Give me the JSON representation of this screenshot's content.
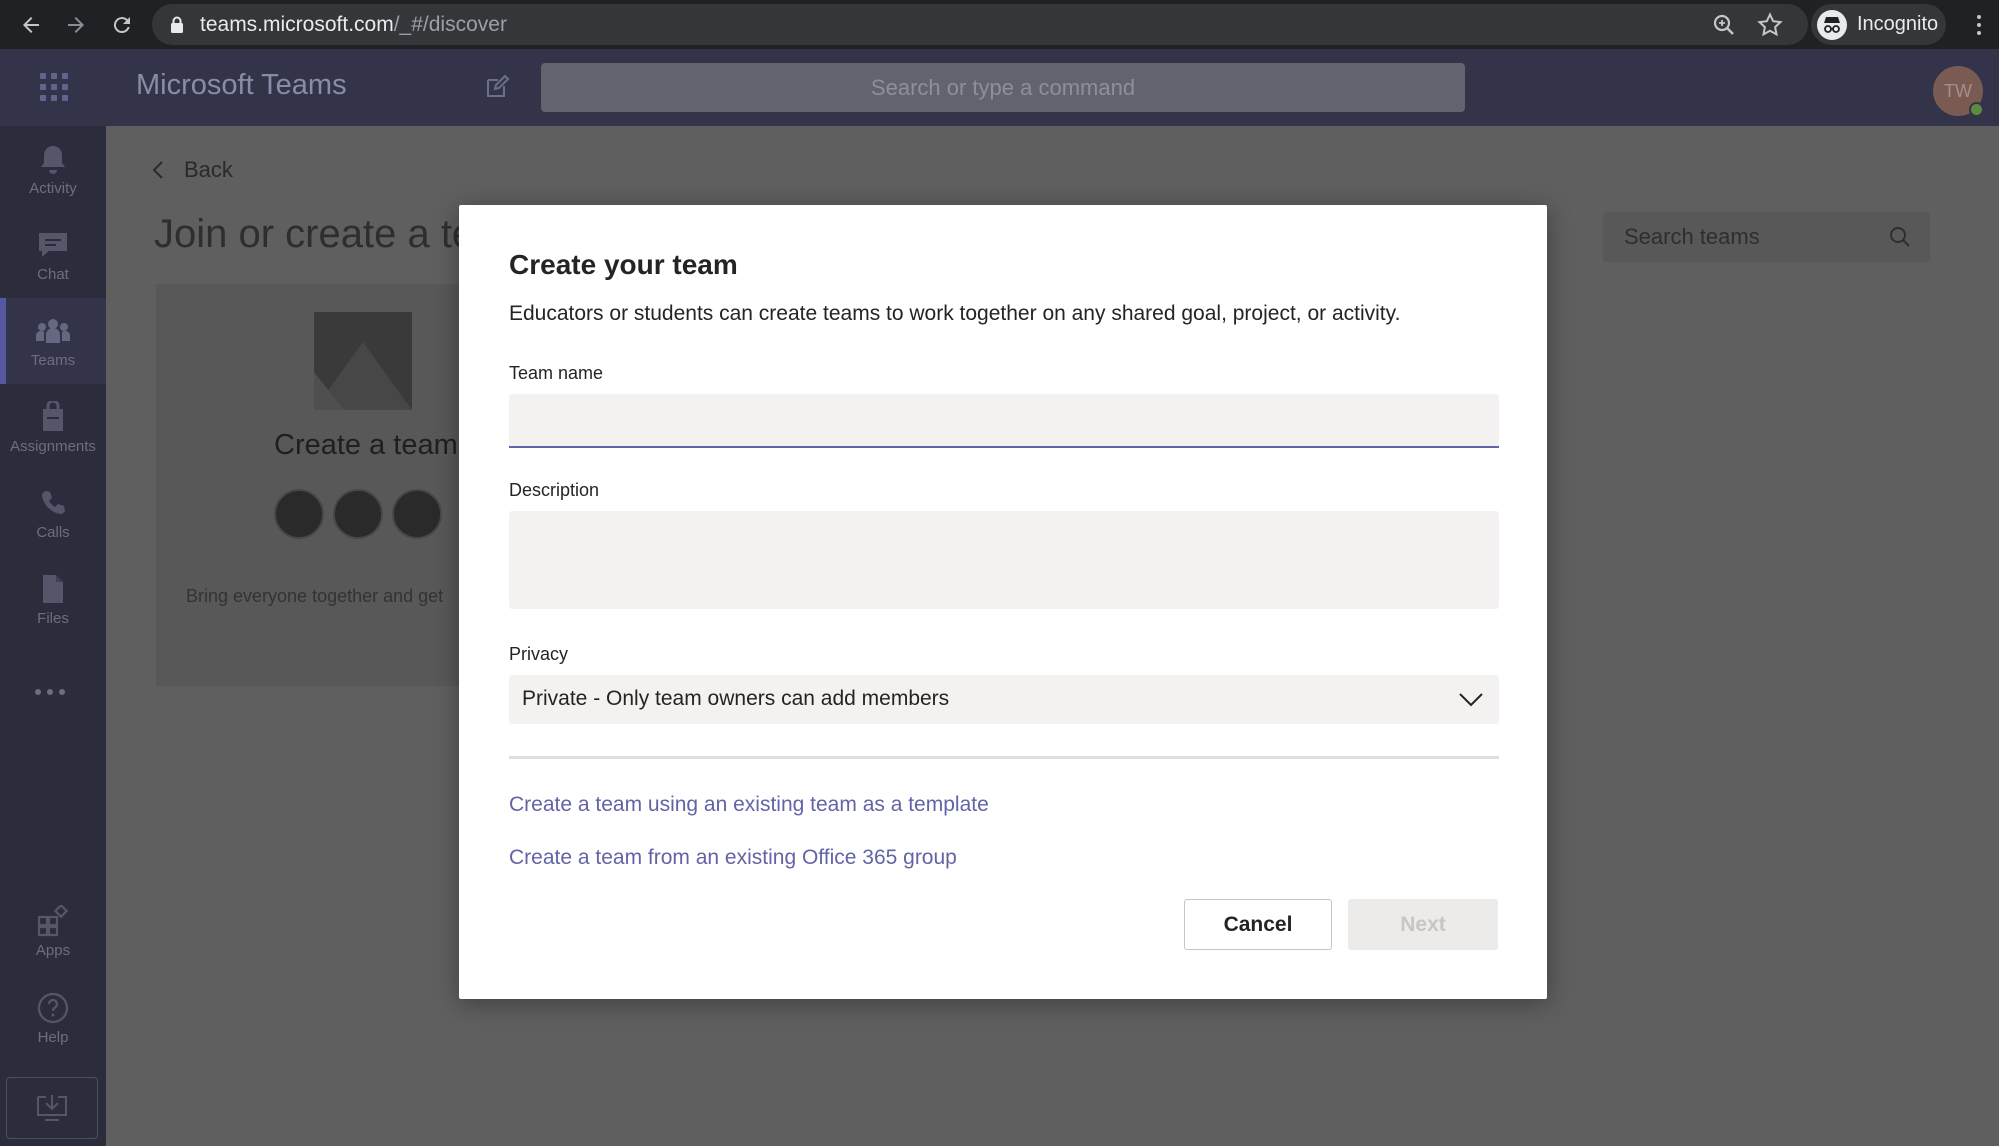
{
  "browser": {
    "url_host": "teams.microsoft.com",
    "url_path": "/_#/discover",
    "profile_label": "Incognito"
  },
  "teams_header": {
    "app_title": "Microsoft Teams",
    "search_placeholder": "Search or type a command",
    "avatar_initials": "TW"
  },
  "rail": {
    "items": [
      {
        "label": "Activity",
        "icon": "bell-icon"
      },
      {
        "label": "Chat",
        "icon": "chat-icon"
      },
      {
        "label": "Teams",
        "icon": "teams-icon"
      },
      {
        "label": "Assignments",
        "icon": "assignments-icon"
      },
      {
        "label": "Calls",
        "icon": "phone-icon"
      },
      {
        "label": "Files",
        "icon": "file-icon"
      }
    ],
    "bottom_items": [
      {
        "label": "Apps",
        "icon": "apps-icon"
      },
      {
        "label": "Help",
        "icon": "help-icon"
      }
    ]
  },
  "page": {
    "back_label": "Back",
    "title": "Join or create a tea",
    "create_card_title": "Create a team",
    "create_card_desc": "Bring everyone together and get",
    "search_teams_placeholder": "Search teams"
  },
  "modal": {
    "title": "Create your team",
    "subtitle": "Educators or students can create teams to work together on any shared goal, project, or activity.",
    "team_name_label": "Team name",
    "team_name_value": "",
    "description_label": "Description",
    "description_value": "",
    "privacy_label": "Privacy",
    "privacy_value": "Private - Only team owners can add members",
    "template_link": "Create a team using an existing team as a template",
    "office_link": "Create a team from an existing Office 365 group",
    "cancel_label": "Cancel",
    "next_label": "Next"
  },
  "colors": {
    "accent": "#6264a7",
    "header_bg": "#33344a",
    "rail_bg": "#2c2d3c"
  }
}
